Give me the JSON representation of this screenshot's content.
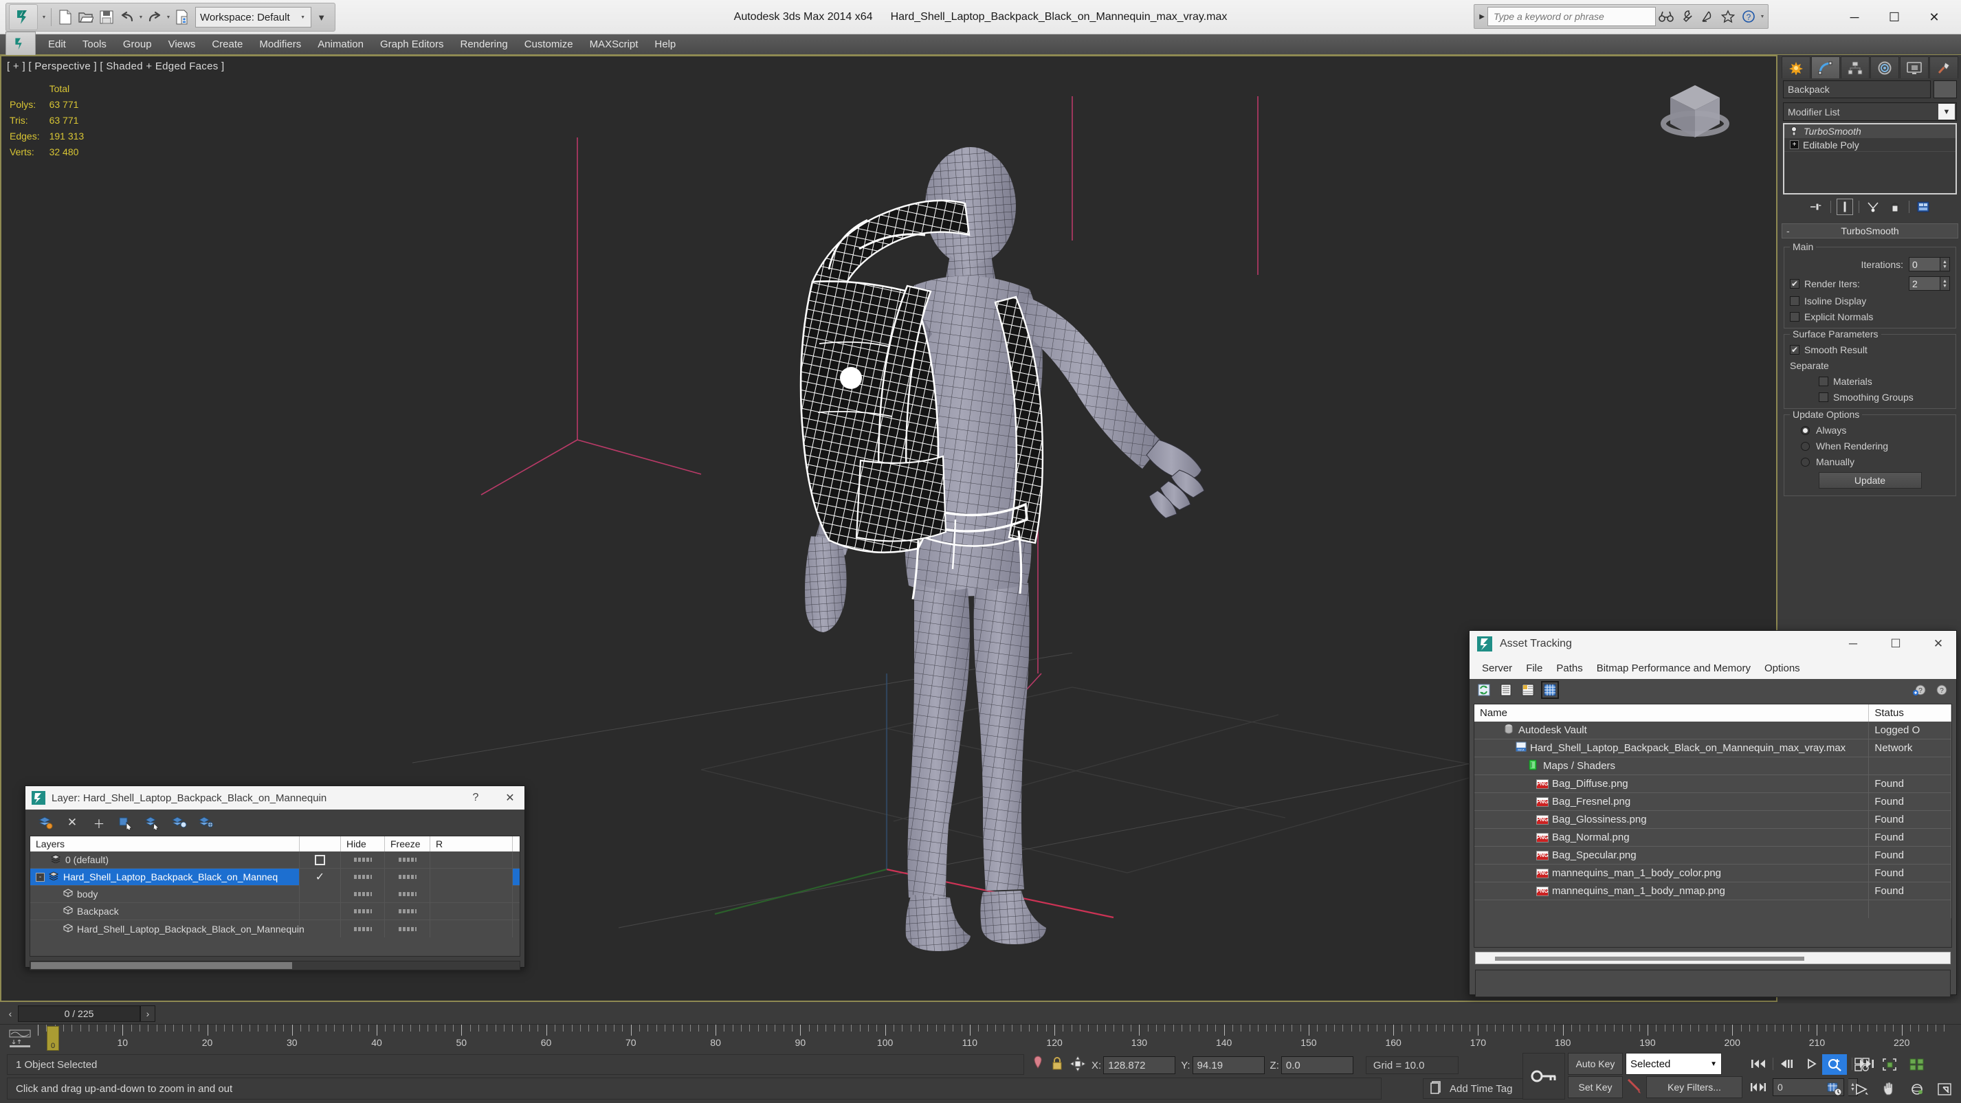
{
  "app": {
    "title": "Autodesk 3ds Max  2014 x64",
    "document": "Hard_Shell_Laptop_Backpack_Black_on_Mannequin_max_vray.max",
    "workspace": "Workspace: Default",
    "search_placeholder": "Type a keyword or phrase"
  },
  "quick_access": {
    "new": "new-file-icon",
    "open": "open-file-icon",
    "save": "save-icon",
    "undo": "undo-icon",
    "redo": "redo-icon",
    "set_project": "set-project-folder-icon"
  },
  "title_search_icons": [
    "binoculars-icon",
    "wrench-icon",
    "satellite-dish-icon",
    "star-icon",
    "help-icon"
  ],
  "window_buttons": {
    "minimize": "─",
    "maximize": "☐",
    "close": "✕"
  },
  "menu": {
    "items": [
      "Edit",
      "Tools",
      "Group",
      "Views",
      "Create",
      "Modifiers",
      "Animation",
      "Graph Editors",
      "Rendering",
      "Customize",
      "MAXScript",
      "Help"
    ]
  },
  "viewport": {
    "label": "[ + ] [ Perspective ] [ Shaded + Edged Faces ]",
    "stats": {
      "header": "Total",
      "rows": [
        {
          "label": "Polys:",
          "value": "63 771"
        },
        {
          "label": "Tris:",
          "value": "63 771"
        },
        {
          "label": "Edges:",
          "value": "191 313"
        },
        {
          "label": "Verts:",
          "value": "32 480"
        }
      ]
    },
    "gizmo": "view-cube-icon",
    "accent_border": "#8f8a52",
    "background": "#2b2b2b",
    "mesh_color": "#9a9aae",
    "wire_color": "#1c1c1c",
    "selection_color": "#ffffff",
    "grid_color": "#d8366e"
  },
  "command_panel": {
    "tabs": [
      {
        "name": "create-tab",
        "icon": "star-burst-icon",
        "active": false
      },
      {
        "name": "modify-tab",
        "icon": "bent-curve-icon",
        "active": true
      },
      {
        "name": "hierarchy-tab",
        "icon": "hierarchy-icon",
        "active": false
      },
      {
        "name": "motion-tab",
        "icon": "motion-wheel-icon",
        "active": false
      },
      {
        "name": "display-tab",
        "icon": "monitor-icon",
        "active": false
      },
      {
        "name": "utilities-tab",
        "icon": "hammer-icon",
        "active": false
      }
    ],
    "object_name": "Backpack",
    "modifier_list_label": "Modifier List",
    "modifier_stack": [
      {
        "label": "TurboSmooth",
        "selected": true
      },
      {
        "label": "Editable Poly",
        "selected": false
      }
    ],
    "stack_buttons": [
      "pin-stack-icon",
      "show-end-result-icon",
      "make-unique-icon",
      "remove-modifier-icon",
      "configure-modifier-sets-icon"
    ],
    "rollout": {
      "title": "TurboSmooth",
      "main": {
        "title": "Main",
        "iterations_label": "Iterations:",
        "iterations_value": "0",
        "render_iters_label": "Render Iters:",
        "render_iters_value": "2",
        "render_iters_checked": true,
        "isoline_display_label": "Isoline Display",
        "isoline_display_checked": false,
        "explicit_normals_label": "Explicit Normals",
        "explicit_normals_checked": false
      },
      "surface": {
        "title": "Surface Parameters",
        "smooth_result_label": "Smooth Result",
        "smooth_result_checked": true,
        "separate_label": "Separate",
        "materials_label": "Materials",
        "materials_checked": false,
        "smoothing_groups_label": "Smoothing Groups",
        "smoothing_groups_checked": false
      },
      "update": {
        "title": "Update Options",
        "options": [
          {
            "label": "Always",
            "selected": true
          },
          {
            "label": "When Rendering",
            "selected": false
          },
          {
            "label": "Manually",
            "selected": false
          }
        ],
        "button": "Update"
      }
    }
  },
  "layer_dialog": {
    "title": "Layer: Hard_Shell_Laptop_Backpack_Black_on_Mannequin",
    "icon": "max-file-icon",
    "help_button": "?",
    "close_button": "✕",
    "toolbar": [
      "new-layer-icon",
      "delete-layer-icon",
      "add-layer-icon",
      "select-objects-icon",
      "select-highlighted-icon",
      "highlight-selected-icon",
      "layer-properties-icon"
    ],
    "columns": [
      "Layers",
      "",
      "Hide",
      "Freeze",
      "R"
    ],
    "rows": [
      {
        "name": "0 (default)",
        "indent": 1,
        "icon": "layer-icon",
        "selected": false,
        "expander": "",
        "check": "empty-box"
      },
      {
        "name": "Hard_Shell_Laptop_Backpack_Black_on_Manneq",
        "indent": 1,
        "icon": "layer-icon",
        "selected": true,
        "expander": "-",
        "check": "✓"
      },
      {
        "name": "body",
        "indent": 2,
        "icon": "object-icon",
        "selected": false,
        "expander": "",
        "check": ""
      },
      {
        "name": "Backpack",
        "indent": 2,
        "icon": "object-icon",
        "selected": false,
        "expander": "",
        "check": ""
      },
      {
        "name": "Hard_Shell_Laptop_Backpack_Black_on_Mannequin",
        "indent": 2,
        "icon": "object-icon",
        "selected": false,
        "expander": "",
        "check": ""
      }
    ]
  },
  "asset_tracking": {
    "title": "Asset Tracking",
    "icon": "max-app-icon",
    "window_buttons": {
      "minimize": "─",
      "maximize": "☐",
      "close": "✕"
    },
    "menu": [
      "Server",
      "File",
      "Paths",
      "Bitmap Performance and Memory",
      "Options"
    ],
    "toolbar": [
      "refresh-icon",
      "list-view-icon",
      "detail-view-icon",
      "grid-view-icon"
    ],
    "toolbar_right": [
      "help-add-icon",
      "help-icon"
    ],
    "columns": [
      "Name",
      "Status"
    ],
    "rows": [
      {
        "name": "Autodesk Vault",
        "status": "Logged O",
        "indent": 1,
        "icon": "vault-icon"
      },
      {
        "name": "Hard_Shell_Laptop_Backpack_Black_on_Mannequin_max_vray.max",
        "status": "Network",
        "indent": 2,
        "icon": "max-file-icon"
      },
      {
        "name": "Maps / Shaders",
        "status": "",
        "indent": 3,
        "icon": "maps-shaders-icon"
      },
      {
        "name": "Bag_Diffuse.png",
        "status": "Found",
        "indent": 4,
        "icon": "png-icon"
      },
      {
        "name": "Bag_Fresnel.png",
        "status": "Found",
        "indent": 4,
        "icon": "png-icon"
      },
      {
        "name": "Bag_Glossiness.png",
        "status": "Found",
        "indent": 4,
        "icon": "png-icon"
      },
      {
        "name": "Bag_Normal.png",
        "status": "Found",
        "indent": 4,
        "icon": "png-icon"
      },
      {
        "name": "Bag_Specular.png",
        "status": "Found",
        "indent": 4,
        "icon": "png-icon"
      },
      {
        "name": "mannequins_man_1_body_color.png",
        "status": "Found",
        "indent": 4,
        "icon": "png-icon"
      },
      {
        "name": "mannequins_man_1_body_nmap.png",
        "status": "Found",
        "indent": 4,
        "icon": "png-icon"
      }
    ]
  },
  "timeline": {
    "frame_indicator": "0 / 225",
    "prev_arrow": "‹",
    "next_arrow": "›",
    "current_frame": "0",
    "ticks": [
      0,
      10,
      20,
      30,
      40,
      50,
      60,
      70,
      80,
      90,
      100,
      110,
      120,
      130,
      140,
      150,
      160,
      170,
      180,
      190,
      200,
      210,
      220
    ],
    "key_mode_icon": "key-mode-toggle-icon"
  },
  "status_bar": {
    "selection": "1 Object Selected",
    "prompt": "Click and drag up-and-down to zoom in and out",
    "pin_icon": "pin-stack-icon",
    "lock_icon": "selection-lock-icon",
    "transform_icon": "absolute-relative-icon",
    "coords": [
      {
        "axis": "X:",
        "value": "128.872"
      },
      {
        "axis": "Y:",
        "value": "94.19"
      },
      {
        "axis": "Z:",
        "value": "0.0"
      }
    ],
    "grid": "Grid = 10.0",
    "add_time_tag": "Add Time Tag"
  },
  "animation_controls": {
    "key_toggle_icon": "key-icon",
    "auto_key": "Auto Key",
    "set_key": "Set Key",
    "selection_set": "Selected",
    "key_filters": "Key Filters...",
    "spinner_value": "0",
    "playback": [
      "go-to-start-icon",
      "previous-frame-icon",
      "play-icon",
      "next-frame-icon",
      "go-to-end-icon"
    ],
    "nav_top": [
      "zoom-icon",
      "zoom-all-icon",
      "zoom-extents-icon",
      "zoom-extents-all-icon"
    ],
    "nav_bottom": [
      "time-config-icon",
      "field-of-view-icon",
      "pan-icon",
      "orbit-icon",
      "maximize-viewport-icon"
    ]
  }
}
